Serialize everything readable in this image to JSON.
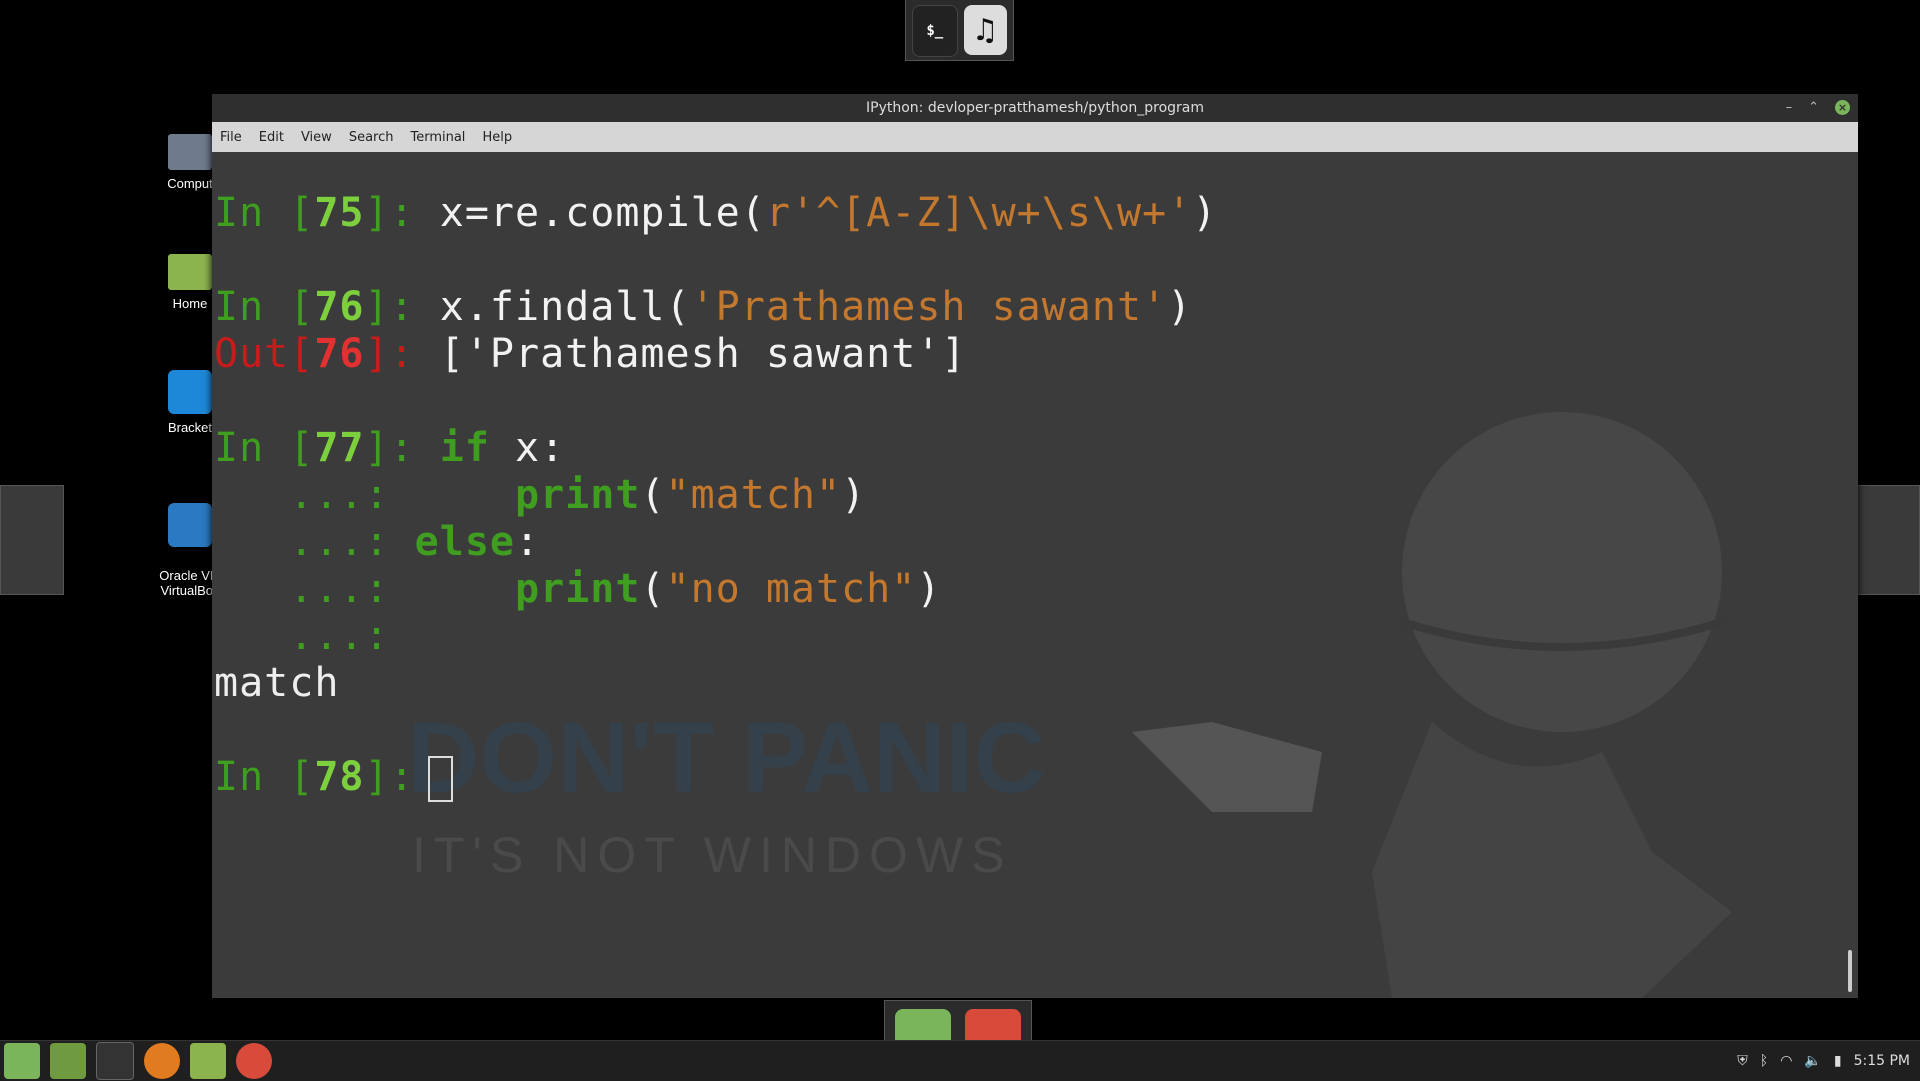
{
  "window": {
    "title": "IPython: devloper-pratthamesh/python_program",
    "minimize": "–",
    "restore": "⌃",
    "close": "×"
  },
  "menu": [
    "File",
    "Edit",
    "View",
    "Search",
    "Terminal",
    "Help"
  ],
  "desktop_icons": [
    "Comput",
    "Home",
    "Bracket",
    "Oracle VM\nVirtualBox"
  ],
  "terminal": {
    "in_prompt": "In [",
    "out_prompt": "Out[",
    "close_prompt": "]: ",
    "cont_prompt": "   ...: ",
    "lines": [
      {
        "n": "75",
        "code": "x=re.compile(",
        "str": "r'^[A-Z]\\w+\\s\\w+'",
        "end": ")"
      },
      {
        "n": "76",
        "code": "x.findall(",
        "str": "'Prathamesh sawant'",
        "end": ")"
      },
      {
        "n": "76",
        "out": "['Prathamesh sawant']"
      },
      {
        "n": "77",
        "kw": "if",
        "rest": " x:"
      },
      {
        "kw": "print",
        "open": "(",
        "str": "\"match\"",
        "end": ")"
      },
      {
        "kw": "else",
        "rest": ":"
      },
      {
        "kw": "print",
        "open": "(",
        "str": "\"no match\"",
        "end": ")"
      },
      {
        "output": "match"
      },
      {
        "n": "78"
      }
    ]
  },
  "wallpaper": {
    "line1": "DON'T PANIC",
    "line2": "IT'S NOT WINDOWS"
  },
  "top_dock": {
    "terminal_label": "$_",
    "music_icon": "♫"
  },
  "clock": "5:15 PM",
  "colors": {
    "prompt_green": "#3f9d1f",
    "number_green": "#7dd03d",
    "out_red": "#c91b1b",
    "string_orange": "#c4782e"
  }
}
